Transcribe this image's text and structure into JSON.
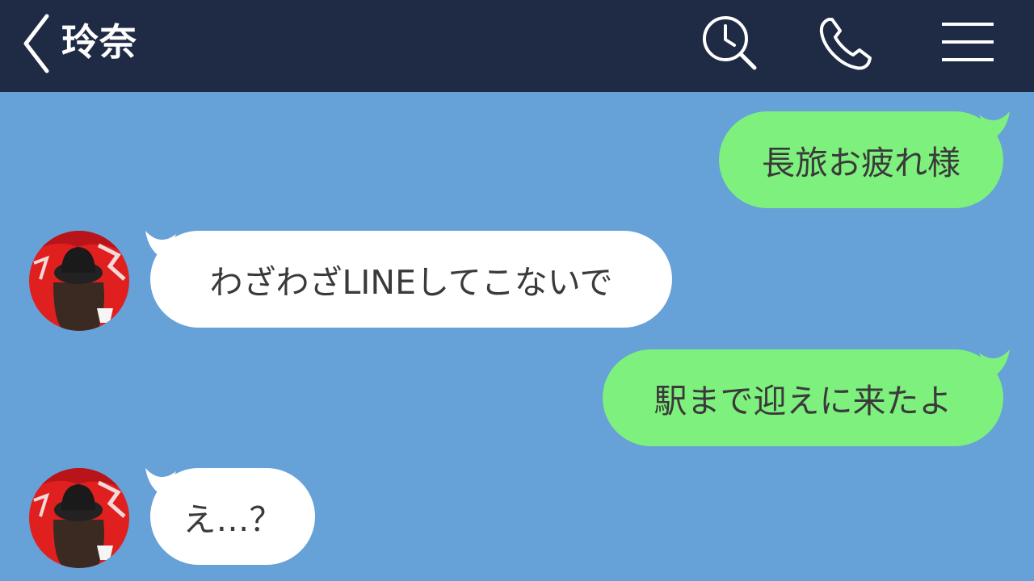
{
  "header": {
    "title": "玲奈",
    "back_icon": "chevron-left-icon",
    "search_icon": "search-history-icon",
    "call_icon": "phone-icon",
    "menu_icon": "hamburger-menu-icon"
  },
  "colors": {
    "header_bg": "#1f2a44",
    "chat_bg": "#66a1d7",
    "sent_bubble": "#7ef07d",
    "received_bubble": "#ffffff",
    "text": "#3a3a3a"
  },
  "messages": [
    {
      "sender": "me",
      "text": "長旅お疲れ様"
    },
    {
      "sender": "玲奈",
      "text": "わざわざLINEしてこないで"
    },
    {
      "sender": "me",
      "text": "駅まで迎えに来たよ"
    },
    {
      "sender": "玲奈",
      "text": "え…？"
    }
  ]
}
